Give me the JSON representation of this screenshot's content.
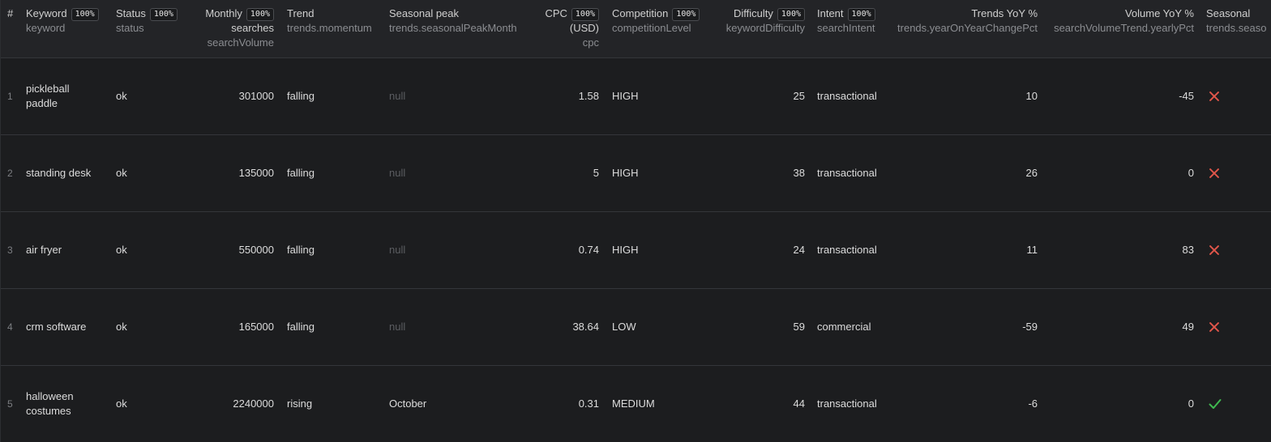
{
  "columns": [
    {
      "id": "rownum",
      "title": "#",
      "field": "",
      "badge": ""
    },
    {
      "id": "keyword",
      "title": "Keyword",
      "field": "keyword",
      "badge": "100%"
    },
    {
      "id": "status",
      "title": "Status",
      "field": "status",
      "badge": "100%"
    },
    {
      "id": "searchVolume",
      "title": "Monthly",
      "title2": "searches",
      "field": "searchVolume",
      "badge": "100%"
    },
    {
      "id": "momentum",
      "title": "Trend",
      "field": "trends.momentum",
      "badge": ""
    },
    {
      "id": "seasonalPeak",
      "title": "Seasonal peak",
      "field": "trends.seasonalPeakMonth",
      "badge": ""
    },
    {
      "id": "cpc",
      "title": "CPC",
      "title2": "(USD)",
      "field": "cpc",
      "badge": "100%"
    },
    {
      "id": "competition",
      "title": "Competition",
      "field": "competitionLevel",
      "badge": "100%"
    },
    {
      "id": "difficulty",
      "title": "Difficulty",
      "field": "keywordDifficulty",
      "badge": "100%"
    },
    {
      "id": "intent",
      "title": "Intent",
      "field": "searchIntent",
      "badge": "100%"
    },
    {
      "id": "trendsYoy",
      "title": "Trends YoY %",
      "field": "trends.yearOnYearChangePct",
      "badge": ""
    },
    {
      "id": "volumeYoy",
      "title": "Volume YoY %",
      "field": "searchVolumeTrend.yearlyPct",
      "badge": ""
    },
    {
      "id": "seasonal",
      "title": "Seasonal",
      "field": "trends.seaso",
      "badge": ""
    }
  ],
  "rows": [
    {
      "num": "1",
      "keyword": "pickleball paddle",
      "status": "ok",
      "searchVolume": "301000",
      "momentum": "falling",
      "seasonalPeak": "null",
      "cpc": "1.58",
      "competition": "HIGH",
      "difficulty": "25",
      "intent": "transactional",
      "trendsYoy": "10",
      "volumeYoy": "-45",
      "seasonal": "false"
    },
    {
      "num": "2",
      "keyword": "standing desk",
      "status": "ok",
      "searchVolume": "135000",
      "momentum": "falling",
      "seasonalPeak": "null",
      "cpc": "5",
      "competition": "HIGH",
      "difficulty": "38",
      "intent": "transactional",
      "trendsYoy": "26",
      "volumeYoy": "0",
      "seasonal": "false"
    },
    {
      "num": "3",
      "keyword": "air fryer",
      "status": "ok",
      "searchVolume": "550000",
      "momentum": "falling",
      "seasonalPeak": "null",
      "cpc": "0.74",
      "competition": "HIGH",
      "difficulty": "24",
      "intent": "transactional",
      "trendsYoy": "11",
      "volumeYoy": "83",
      "seasonal": "false"
    },
    {
      "num": "4",
      "keyword": "crm software",
      "status": "ok",
      "searchVolume": "165000",
      "momentum": "falling",
      "seasonalPeak": "null",
      "cpc": "38.64",
      "competition": "LOW",
      "difficulty": "59",
      "intent": "commercial",
      "trendsYoy": "-59",
      "volumeYoy": "49",
      "seasonal": "false"
    },
    {
      "num": "5",
      "keyword": "halloween costumes",
      "status": "ok",
      "searchVolume": "2240000",
      "momentum": "rising",
      "seasonalPeak": "October",
      "cpc": "0.31",
      "competition": "MEDIUM",
      "difficulty": "44",
      "intent": "transactional",
      "trendsYoy": "-6",
      "volumeYoy": "0",
      "seasonal": "true"
    }
  ],
  "colors": {
    "background": "#1c1d1f",
    "header": "#232427",
    "falseIcon": "#e0564a",
    "trueIcon": "#3fb950",
    "nullText": "#5b5d61"
  },
  "icons": {
    "false": "close-icon",
    "true": "check-icon"
  }
}
